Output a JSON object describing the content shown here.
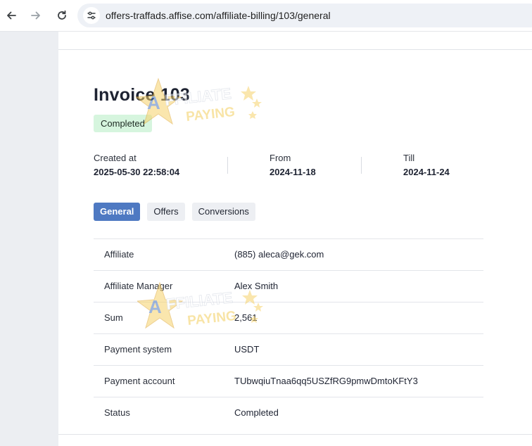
{
  "browser": {
    "url": "offers-traffads.affise.com/affiliate-billing/103/general",
    "icons": [
      "arrow-back-icon",
      "arrow-forward-icon",
      "reload-icon",
      "site-info-icon"
    ]
  },
  "invoice": {
    "title": "Invoice 103",
    "status_badge": "Completed",
    "badge_color": "#d6f5de",
    "meta": {
      "created_label": "Created at",
      "created_value": "2025-05-30 22:58:04",
      "from_label": "From",
      "from_value": "2024-11-18",
      "till_label": "Till",
      "till_value": "2024-11-24"
    },
    "tabs": [
      {
        "label": "General",
        "active": true
      },
      {
        "label": "Offers",
        "active": false
      },
      {
        "label": "Conversions",
        "active": false
      }
    ],
    "accent_color": "#4e79c2",
    "details": [
      {
        "label": "Affiliate",
        "value": "(885) aleca@gek.com"
      },
      {
        "label": "Affiliate Manager",
        "value": "Alex Smith"
      },
      {
        "label": "Sum",
        "value": "2,561"
      },
      {
        "label": "Payment system",
        "value": "USDT"
      },
      {
        "label": "Payment account",
        "value": "TUbwqiuTnaa6qq5USZfRG9pmwDmtoKFtY3"
      },
      {
        "label": "Status",
        "value": "Completed"
      }
    ]
  },
  "watermark": {
    "line1": "AFFILIATE",
    "line2": "PAYING"
  }
}
